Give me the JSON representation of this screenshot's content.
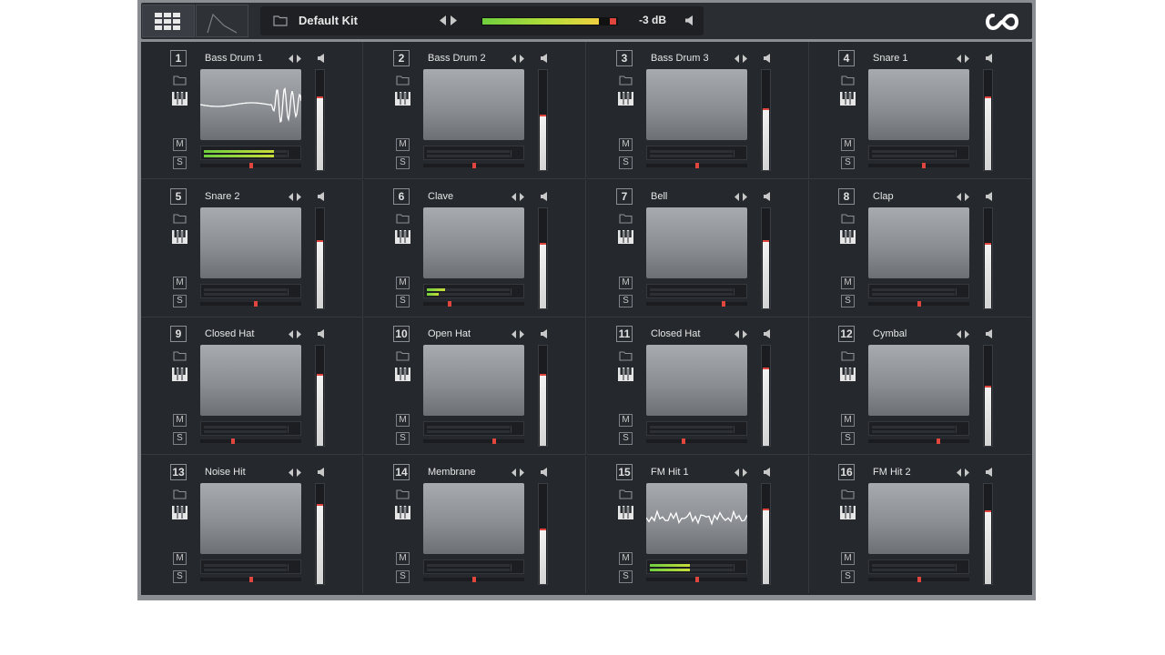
{
  "toolbar": {
    "kit_name": "Default Kit",
    "master_level_db": "-3 dB",
    "master_meter_fraction": 0.93
  },
  "icons": {
    "grid": "grid-icon",
    "envelope": "envelope-icon",
    "folder": "folder-icon",
    "arrows": "prev-next-arrows-icon",
    "speaker": "speaker-icon",
    "keys": "piano-keys-icon",
    "logo": "infinity-logo-icon"
  },
  "pad_labels": {
    "mute": "M",
    "solo": "S"
  },
  "colors": {
    "clip": "#e0463e",
    "meter_green": "#6fcf3f",
    "fader": "#e8e8e8"
  },
  "pads": [
    {
      "num": "1",
      "name": "Bass Drum 1",
      "volume": 0.72,
      "pan": 0.5,
      "level1": 0.85,
      "level2": 0.85,
      "waveform": "kick"
    },
    {
      "num": "2",
      "name": "Bass Drum 2",
      "volume": 0.54,
      "pan": 0.5,
      "level1": 0,
      "level2": 0,
      "waveform": "none"
    },
    {
      "num": "3",
      "name": "Bass Drum 3",
      "volume": 0.6,
      "pan": 0.5,
      "level1": 0,
      "level2": 0,
      "waveform": "none"
    },
    {
      "num": "4",
      "name": "Snare 1",
      "volume": 0.72,
      "pan": 0.55,
      "level1": 0,
      "level2": 0,
      "waveform": "none"
    },
    {
      "num": "5",
      "name": "Snare 2",
      "volume": 0.66,
      "pan": 0.55,
      "level1": 0,
      "level2": 0,
      "waveform": "none"
    },
    {
      "num": "6",
      "name": "Clave",
      "volume": 0.64,
      "pan": 0.25,
      "level1": 0.22,
      "level2": 0.14,
      "waveform": "none"
    },
    {
      "num": "7",
      "name": "Bell",
      "volume": 0.66,
      "pan": 0.78,
      "level1": 0,
      "level2": 0,
      "waveform": "none"
    },
    {
      "num": "8",
      "name": "Clap",
      "volume": 0.64,
      "pan": 0.5,
      "level1": 0,
      "level2": 0,
      "waveform": "none"
    },
    {
      "num": "9",
      "name": "Closed Hat",
      "volume": 0.7,
      "pan": 0.32,
      "level1": 0,
      "level2": 0,
      "waveform": "none"
    },
    {
      "num": "10",
      "name": "Open Hat",
      "volume": 0.7,
      "pan": 0.71,
      "level1": 0,
      "level2": 0,
      "waveform": "none"
    },
    {
      "num": "11",
      "name": "Closed Hat",
      "volume": 0.76,
      "pan": 0.36,
      "level1": 0,
      "level2": 0,
      "waveform": "none"
    },
    {
      "num": "12",
      "name": "Cymbal",
      "volume": 0.58,
      "pan": 0.7,
      "level1": 0,
      "level2": 0,
      "waveform": "none"
    },
    {
      "num": "13",
      "name": "Noise Hit",
      "volume": 0.78,
      "pan": 0.5,
      "level1": 0,
      "level2": 0,
      "waveform": "none"
    },
    {
      "num": "14",
      "name": "Membrane",
      "volume": 0.54,
      "pan": 0.5,
      "level1": 0,
      "level2": 0,
      "waveform": "none"
    },
    {
      "num": "15",
      "name": "FM Hit 1",
      "volume": 0.74,
      "pan": 0.5,
      "level1": 0.48,
      "level2": 0.48,
      "waveform": "noise"
    },
    {
      "num": "16",
      "name": "FM Hit 2",
      "volume": 0.72,
      "pan": 0.5,
      "level1": 0,
      "level2": 0,
      "waveform": "none"
    }
  ]
}
